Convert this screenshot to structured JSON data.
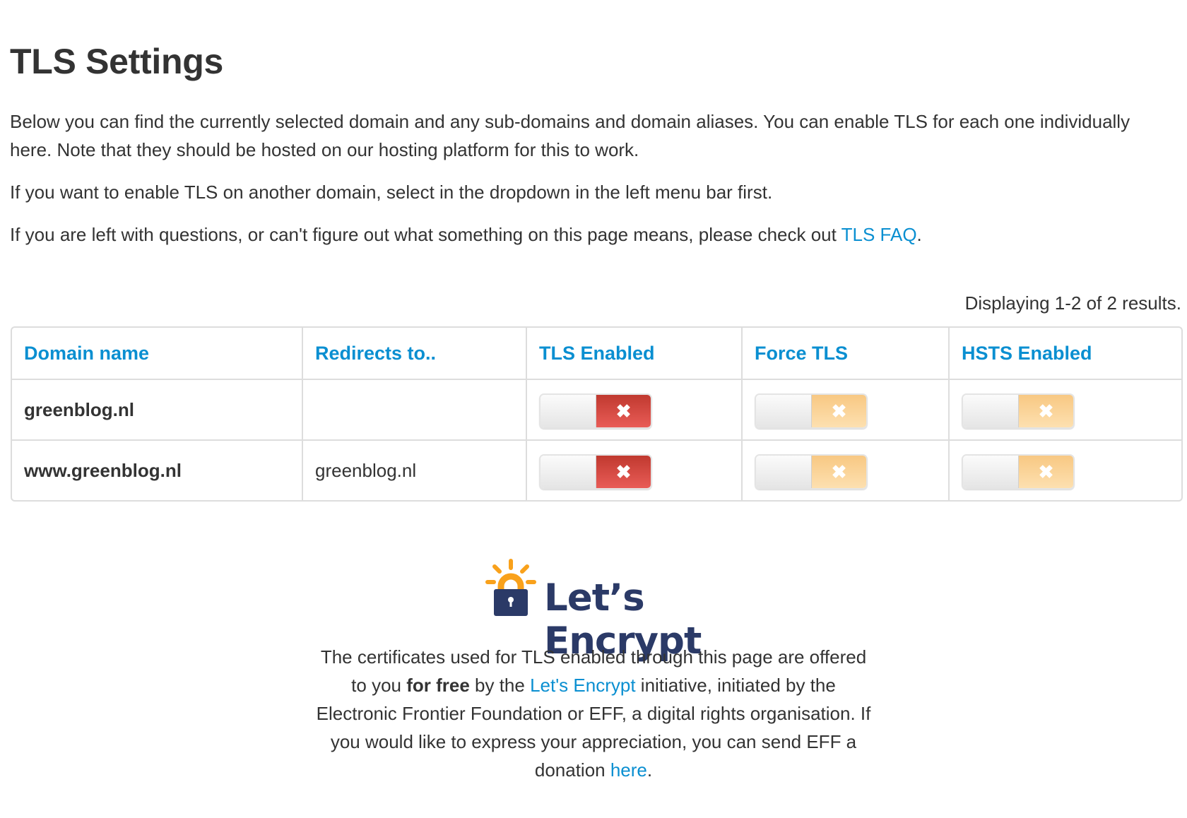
{
  "page": {
    "title": "TLS Settings",
    "intro_p1": "Below you can find the currently selected domain and any sub-domains and domain aliases. You can enable TLS for each one individually here. Note that they should be hosted on our hosting platform for this to work.",
    "intro_p2": "If you want to enable TLS on another domain, select in the dropdown in the left menu bar first.",
    "intro_p3_before": "If you are left with questions, or can't figure out what something on this page means, please check out ",
    "intro_p3_link": "TLS FAQ",
    "intro_p3_after": "."
  },
  "table": {
    "summary": "Displaying 1-2 of 2 results.",
    "headers": [
      "Domain name",
      "Redirects to..",
      "TLS Enabled",
      "Force TLS",
      "HSTS Enabled"
    ],
    "rows": [
      {
        "domain": "greenblog.nl",
        "redirects_to": "",
        "tls_enabled": false,
        "force_tls": false,
        "hsts_enabled": false
      },
      {
        "domain": "www.greenblog.nl",
        "redirects_to": "greenblog.nl",
        "tls_enabled": false,
        "force_tls": false,
        "hsts_enabled": false
      }
    ],
    "toggle_off_glyph": "✖",
    "colors": {
      "tls_off": "#d9443d",
      "force_off": "#f9cf94",
      "hsts_off": "#f9cf94",
      "header_link": "#0a8fd1"
    }
  },
  "letsencrypt": {
    "logo_text": "Let’s Encrypt",
    "logo_icon": "padlock-sun-icon",
    "colors": {
      "navy": "#2b3a67",
      "orange": "#f9a11b"
    },
    "text_1": "The certificates used for TLS enabled through this page are offered to you ",
    "text_bold": "for free",
    "text_2": " by the ",
    "link_1": "Let's Encrypt",
    "text_3": " initiative, initiated by the Electronic Frontier Foundation or EFF, a digital rights organisation. If you would like to express your appreciation, you can send EFF a donation ",
    "link_2": "here",
    "text_4": "."
  }
}
